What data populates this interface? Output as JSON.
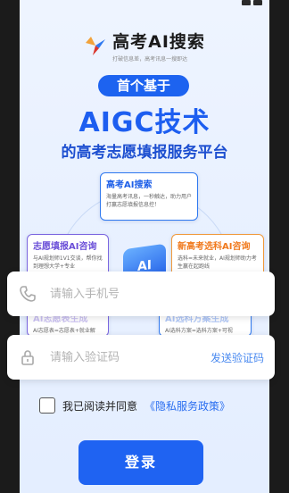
{
  "brand": {
    "title": "高考AI搜索",
    "subtitle": "打破信息差，高考讯息一搜即达"
  },
  "hero": {
    "pill": "首个基于",
    "headline": "AIGC技术",
    "subline": "的高考志愿填报服务平台"
  },
  "features": {
    "top": {
      "title": "高考AI搜索",
      "desc": "海量高考讯息，一秒触达，助力用户打赢志愿填报信息控！"
    },
    "left": {
      "title": "志愿填报AI咨询",
      "desc": "与AI规划师1V1交谈，帮你找到理想大学+专业"
    },
    "right": {
      "title": "新高考选科AI咨询",
      "desc": "选科=未来就业，AI规划师助力考生赢在起跑线"
    },
    "bottom_left": {
      "title": "AI志愿表生成",
      "desc": "AI志愿表=志愿表+就业解"
    },
    "bottom_right": {
      "title": "AI选科方案生成",
      "desc": "AI选科方案=选科方案+可视"
    }
  },
  "ai_badge": "AI",
  "phone_field": {
    "placeholder": "请输入手机号",
    "icon": "phone-icon"
  },
  "code_field": {
    "placeholder": "请输入验证码",
    "icon": "lock-icon",
    "send_label": "发送验证码"
  },
  "agreement": {
    "text": "我已阅读并同意",
    "link": "《隐私服务政策》"
  },
  "login_button": "登录",
  "colors": {
    "primary": "#1f63f2",
    "link": "#2a6ef0",
    "orange": "#f07a1e",
    "purple": "#6b4fd8"
  }
}
